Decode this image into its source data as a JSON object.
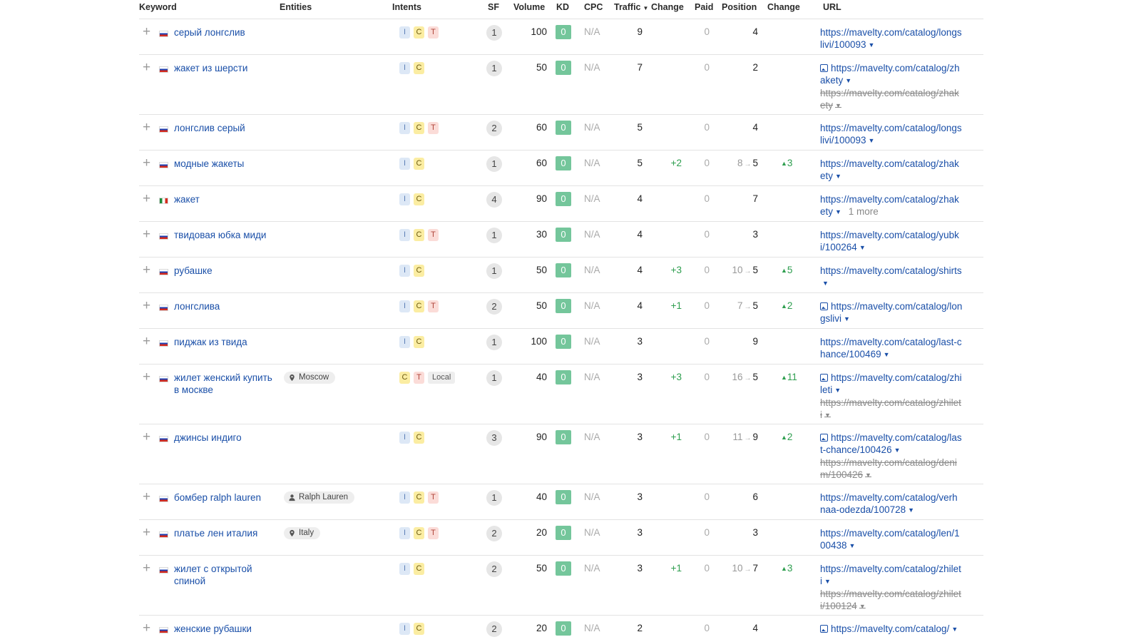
{
  "headers": {
    "keyword": "Keyword",
    "entities": "Entities",
    "intents": "Intents",
    "sf": "SF",
    "volume": "Volume",
    "kd": "KD",
    "cpc": "CPC",
    "traffic": "Traffic",
    "traffic_change": "Change",
    "paid": "Paid",
    "position": "Position",
    "position_change": "Change",
    "url": "URL"
  },
  "sort": {
    "column": "traffic",
    "direction": "descending"
  },
  "rows": [
    {
      "keyword": "серый лонгслив",
      "flag": "ru",
      "entity": null,
      "intents": [
        "I",
        "C",
        "T"
      ],
      "sf": "1",
      "volume": "100",
      "kd": "0",
      "cpc": "N/A",
      "traffic": "9",
      "traffic_change": "",
      "paid": "0",
      "pos_old": "",
      "pos": "4",
      "pos_change": "",
      "urls": [
        {
          "text": "https://mavelty.com/catalog/longslivi/100093",
          "strike": false,
          "img": false
        }
      ]
    },
    {
      "keyword": "жакет из шерсти",
      "flag": "ru",
      "entity": null,
      "intents": [
        "I",
        "C"
      ],
      "sf": "1",
      "volume": "50",
      "kd": "0",
      "cpc": "N/A",
      "traffic": "7",
      "traffic_change": "",
      "paid": "0",
      "pos_old": "",
      "pos": "2",
      "pos_change": "",
      "urls": [
        {
          "text": "https://mavelty.com/catalog/zhakety",
          "strike": false,
          "img": true
        },
        {
          "text": "https://mavelty.com/catalog/zhakety",
          "strike": true,
          "img": false
        }
      ]
    },
    {
      "keyword": "лонгслив серый",
      "flag": "ru",
      "entity": null,
      "intents": [
        "I",
        "C",
        "T"
      ],
      "sf": "2",
      "volume": "60",
      "kd": "0",
      "cpc": "N/A",
      "traffic": "5",
      "traffic_change": "",
      "paid": "0",
      "pos_old": "",
      "pos": "4",
      "pos_change": "",
      "urls": [
        {
          "text": "https://mavelty.com/catalog/longslivi/100093",
          "strike": false,
          "img": false
        }
      ]
    },
    {
      "keyword": "модные жакеты",
      "flag": "ru",
      "entity": null,
      "intents": [
        "I",
        "C"
      ],
      "sf": "1",
      "volume": "60",
      "kd": "0",
      "cpc": "N/A",
      "traffic": "5",
      "traffic_change": "+2",
      "paid": "0",
      "pos_old": "8",
      "pos": "5",
      "pos_change": "3",
      "urls": [
        {
          "text": "https://mavelty.com/catalog/zhakety",
          "strike": false,
          "img": false
        }
      ]
    },
    {
      "keyword": "жакет",
      "flag": "it",
      "entity": null,
      "intents": [
        "I",
        "C"
      ],
      "sf": "4",
      "volume": "90",
      "kd": "0",
      "cpc": "N/A",
      "traffic": "4",
      "traffic_change": "",
      "paid": "0",
      "pos_old": "",
      "pos": "7",
      "pos_change": "",
      "urls": [
        {
          "text": "https://mavelty.com/catalog/zhakety",
          "strike": false,
          "img": false,
          "more": "1 more"
        }
      ]
    },
    {
      "keyword": "твидовая юбка миди",
      "flag": "ru",
      "entity": null,
      "intents": [
        "I",
        "C",
        "T"
      ],
      "sf": "1",
      "volume": "30",
      "kd": "0",
      "cpc": "N/A",
      "traffic": "4",
      "traffic_change": "",
      "paid": "0",
      "pos_old": "",
      "pos": "3",
      "pos_change": "",
      "urls": [
        {
          "text": "https://mavelty.com/catalog/yubki/100264",
          "strike": false,
          "img": false
        }
      ]
    },
    {
      "keyword": "рубашке",
      "flag": "ru",
      "entity": null,
      "intents": [
        "I",
        "C"
      ],
      "sf": "1",
      "volume": "50",
      "kd": "0",
      "cpc": "N/A",
      "traffic": "4",
      "traffic_change": "+3",
      "paid": "0",
      "pos_old": "10",
      "pos": "5",
      "pos_change": "5",
      "urls": [
        {
          "text": "https://mavelty.com/catalog/shirts",
          "strike": false,
          "img": false
        }
      ]
    },
    {
      "keyword": "лонгслива",
      "flag": "ru",
      "entity": null,
      "intents": [
        "I",
        "C",
        "T"
      ],
      "sf": "2",
      "volume": "50",
      "kd": "0",
      "cpc": "N/A",
      "traffic": "4",
      "traffic_change": "+1",
      "paid": "0",
      "pos_old": "7",
      "pos": "5",
      "pos_change": "2",
      "urls": [
        {
          "text": "https://mavelty.com/catalog/longslivi",
          "strike": false,
          "img": true
        }
      ]
    },
    {
      "keyword": "пиджак из твида",
      "flag": "ru",
      "entity": null,
      "intents": [
        "I",
        "C"
      ],
      "sf": "1",
      "volume": "100",
      "kd": "0",
      "cpc": "N/A",
      "traffic": "3",
      "traffic_change": "",
      "paid": "0",
      "pos_old": "",
      "pos": "9",
      "pos_change": "",
      "urls": [
        {
          "text": "https://mavelty.com/catalog/last-chance/100469",
          "strike": false,
          "img": false
        }
      ]
    },
    {
      "keyword": "жилет женский купить в москве",
      "flag": "ru",
      "entity": {
        "type": "location",
        "label": "Moscow"
      },
      "intents": [
        "C",
        "T",
        "Local"
      ],
      "sf": "1",
      "volume": "40",
      "kd": "0",
      "cpc": "N/A",
      "traffic": "3",
      "traffic_change": "+3",
      "paid": "0",
      "pos_old": "16",
      "pos": "5",
      "pos_change": "11",
      "urls": [
        {
          "text": "https://mavelty.com/catalog/zhileti",
          "strike": false,
          "img": true
        },
        {
          "text": "https://mavelty.com/catalog/zhileti",
          "strike": true,
          "img": false
        }
      ]
    },
    {
      "keyword": "джинсы индиго",
      "flag": "ru",
      "entity": null,
      "intents": [
        "I",
        "C"
      ],
      "sf": "3",
      "volume": "90",
      "kd": "0",
      "cpc": "N/A",
      "traffic": "3",
      "traffic_change": "+1",
      "paid": "0",
      "pos_old": "11",
      "pos": "9",
      "pos_change": "2",
      "urls": [
        {
          "text": "https://mavelty.com/catalog/last-chance/100426",
          "strike": false,
          "img": true
        },
        {
          "text": "https://mavelty.com/catalog/denim/100426",
          "strike": true,
          "img": false
        }
      ]
    },
    {
      "keyword": "бомбер ralph lauren",
      "flag": "ru",
      "entity": {
        "type": "person",
        "label": "Ralph Lauren"
      },
      "intents": [
        "I",
        "C",
        "T"
      ],
      "sf": "1",
      "volume": "40",
      "kd": "0",
      "cpc": "N/A",
      "traffic": "3",
      "traffic_change": "",
      "paid": "0",
      "pos_old": "",
      "pos": "6",
      "pos_change": "",
      "urls": [
        {
          "text": "https://mavelty.com/catalog/verhnaa-odezda/100728",
          "strike": false,
          "img": false
        }
      ]
    },
    {
      "keyword": "платье лен италия",
      "flag": "ru",
      "entity": {
        "type": "location",
        "label": "Italy"
      },
      "intents": [
        "I",
        "C",
        "T"
      ],
      "sf": "2",
      "volume": "20",
      "kd": "0",
      "cpc": "N/A",
      "traffic": "3",
      "traffic_change": "",
      "paid": "0",
      "pos_old": "",
      "pos": "3",
      "pos_change": "",
      "urls": [
        {
          "text": "https://mavelty.com/catalog/len/100438",
          "strike": false,
          "img": false
        }
      ]
    },
    {
      "keyword": "жилет с открытой спиной",
      "flag": "ru",
      "entity": null,
      "intents": [
        "I",
        "C"
      ],
      "sf": "2",
      "volume": "50",
      "kd": "0",
      "cpc": "N/A",
      "traffic": "3",
      "traffic_change": "+1",
      "paid": "0",
      "pos_old": "10",
      "pos": "7",
      "pos_change": "3",
      "urls": [
        {
          "text": "https://mavelty.com/catalog/zhileti",
          "strike": false,
          "img": false
        },
        {
          "text": "https://mavelty.com/catalog/zhileti/100124",
          "strike": true,
          "img": false
        }
      ]
    },
    {
      "keyword": "женские рубашки",
      "flag": "ru",
      "entity": null,
      "intents": [
        "I",
        "C"
      ],
      "sf": "2",
      "volume": "20",
      "kd": "0",
      "cpc": "N/A",
      "traffic": "2",
      "traffic_change": "",
      "paid": "0",
      "pos_old": "",
      "pos": "4",
      "pos_change": "",
      "urls": [
        {
          "text": "https://mavelty.com/catalog/",
          "strike": false,
          "img": true
        }
      ]
    }
  ]
}
